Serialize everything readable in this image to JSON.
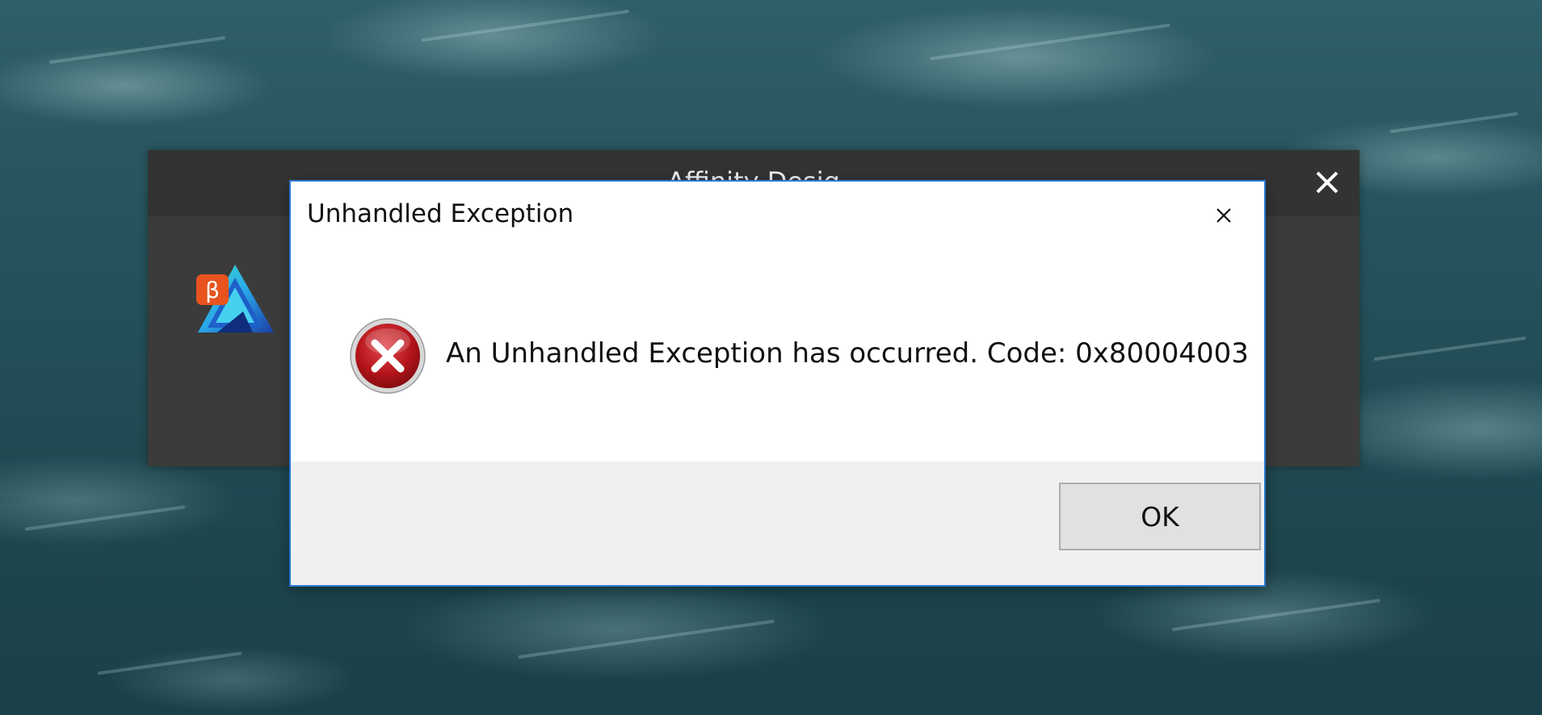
{
  "background_window": {
    "title": "Affinity Desig",
    "close_icon": "close-icon",
    "logo_icon": "affinity-designer-beta-logo-icon",
    "logo_badge": "β"
  },
  "dialog": {
    "title": "Unhandled Exception",
    "close_icon": "close-icon",
    "error_icon": "error-icon",
    "message": "An Unhandled Exception has occurred. Code: 0x80004003",
    "ok_label": "OK"
  },
  "colors": {
    "dialog_border": "#2b79d0",
    "error_red": "#c4161c",
    "footer_bg": "#f0f0f0",
    "splash_bg": "#3b3b3b",
    "badge_orange": "#e8531e"
  }
}
